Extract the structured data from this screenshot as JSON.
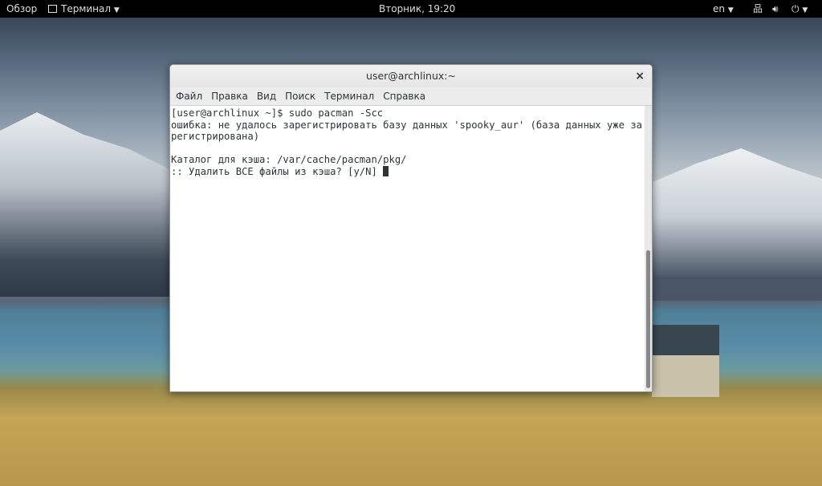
{
  "topbar": {
    "activities": "Обзор",
    "app": "Терминал",
    "clock": "Вторник, 19:20",
    "lang": "en"
  },
  "window": {
    "title": "user@archlinux:~",
    "close": "×",
    "menu": [
      "Файл",
      "Правка",
      "Вид",
      "Поиск",
      "Терминал",
      "Справка"
    ],
    "lines": [
      "[user@archlinux ~]$ sudo pacman -Scc",
      "ошибка: не удалось зарегистрировать базу данных 'spooky_aur' (база данных уже за",
      "регистрирована)",
      "",
      "Каталог для кэша: /var/cache/pacman/pkg/",
      ":: Удалить ВСЕ файлы из кэша? [y/N] "
    ]
  }
}
